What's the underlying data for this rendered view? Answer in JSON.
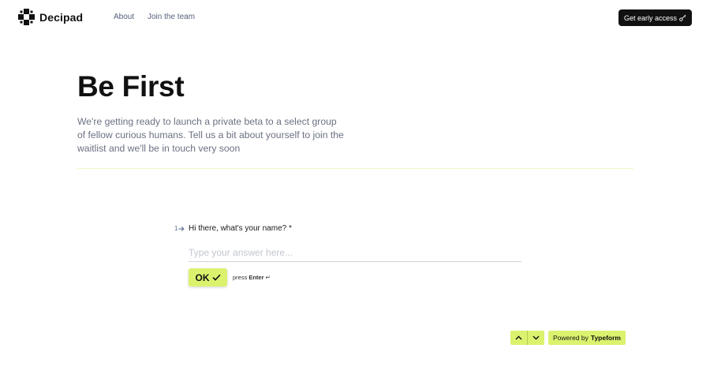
{
  "header": {
    "brand": "Decipad",
    "nav": [
      {
        "label": "About"
      },
      {
        "label": "Join the team"
      }
    ],
    "cta_label": "Get early access"
  },
  "hero": {
    "title": "Be First",
    "description": "We're getting ready to launch a private beta to a select group of fellow curious humans. Tell us a bit about yourself to join the waitlist and we'll be in touch very soon"
  },
  "form": {
    "question_number": "1",
    "question": "Hi there, what's your name? *",
    "answer_value": "",
    "answer_placeholder": "Type your answer here...",
    "ok_label": "OK",
    "hint_press": "press",
    "hint_key": "Enter",
    "hint_symbol": "↵"
  },
  "footer": {
    "powered_prefix": "Powered by",
    "powered_brand": "Typeform"
  },
  "colors": {
    "accent": "#dbf26e",
    "cta_bg": "#111111"
  }
}
